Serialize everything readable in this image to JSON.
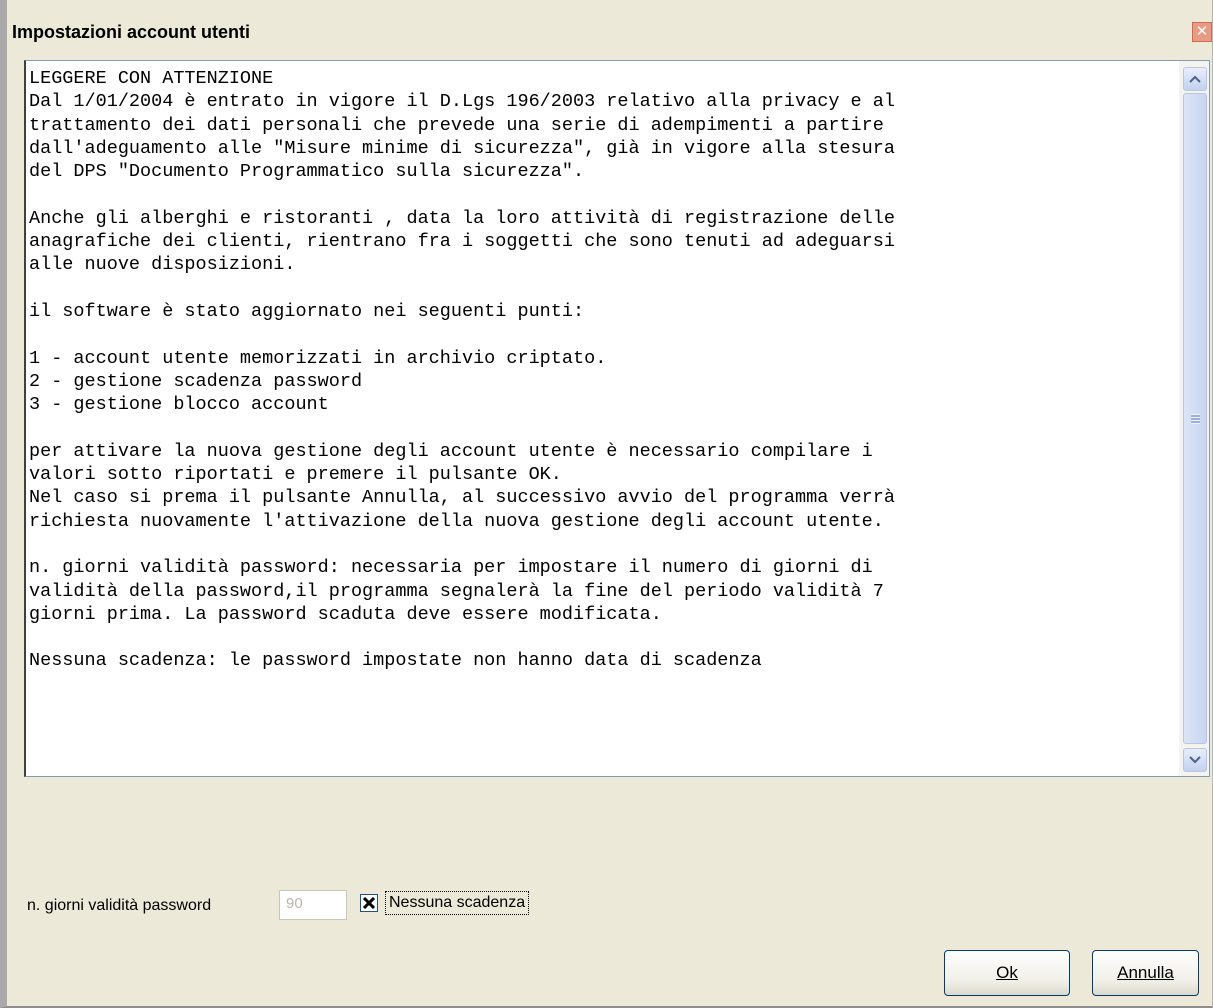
{
  "window": {
    "title": "Impostazioni account utenti",
    "close_glyph": "✕"
  },
  "textbox": {
    "content": "LEGGERE CON ATTENZIONE\nDal 1/01/2004 è entrato in vigore il D.Lgs 196/2003 relativo alla privacy e al\ntrattamento dei dati personali che prevede una serie di adempimenti a partire\ndall'adeguamento alle \"Misure minime di sicurezza\", già in vigore alla stesura\ndel DPS \"Documento Programmatico sulla sicurezza\".\n\nAnche gli alberghi e ristoranti , data la loro attività di registrazione delle\nanagrafiche dei clienti, rientrano fra i soggetti che sono tenuti ad adeguarsi\nalle nuove disposizioni.\n\nil software è stato aggiornato nei seguenti punti:\n\n1 - account utente memorizzati in archivio criptato.\n2 - gestione scadenza password\n3 - gestione blocco account\n\nper attivare la nuova gestione degli account utente è necessario compilare i\nvalori sotto riportati e premere il pulsante OK.\nNel caso si prema il pulsante Annulla, al successivo avvio del programma verrà\nrichiesta nuovamente l'attivazione della nuova gestione degli account utente.\n\nn. giorni validità password: necessaria per impostare il numero di giorni di\nvalidità della password,il programma segnalerà la fine del periodo validità 7\ngiorni prima. La password scaduta deve essere modificata.\n\nNessuna scadenza: le password impostate non hanno data di scadenza"
  },
  "form": {
    "days_label": "n. giorni validità password",
    "days_value": "90",
    "no_expiry_label": "Nessuna scadenza",
    "no_expiry_checked": true
  },
  "buttons": {
    "ok_label": "Ok",
    "cancel_label": "Annulla"
  },
  "icons": {
    "close": "close-icon",
    "scroll_up": "chevron-up-icon",
    "scroll_down": "chevron-down-icon",
    "check": "check-x-icon"
  },
  "colors": {
    "dialog_bg": "#ece9d8",
    "close_button": "#e89a82",
    "scroll_button": "#c2d1f0",
    "button_border": "#003c74"
  }
}
